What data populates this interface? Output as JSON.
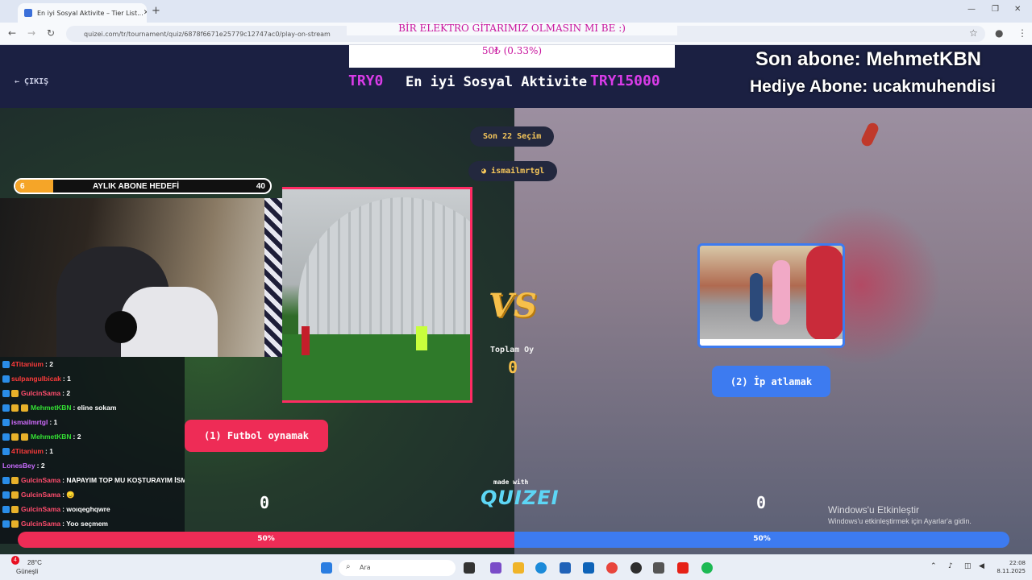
{
  "browser": {
    "tab_title": "En iyi Sosyal Aktivite – Tier List...",
    "url": "quizei.com/tr/tournament/quiz/6878f6671e25779c12747ac0/play-on-stream"
  },
  "header": {
    "exit_label": "ÇIKIŞ",
    "title": "En iyi Sosyal Aktivite",
    "try_left": "TRY0",
    "try_right": "TRY15000"
  },
  "donation": {
    "message": "BİR ELEKTRO GİTARIMIZ OLMASIN MI BE :)",
    "amount": "50₺ (0.33%)"
  },
  "subs": {
    "last_sub": "Son abone: MehmetKBN",
    "gift_sub": "Hediye Abone: ucakmuhendisi"
  },
  "info": {
    "last_picks": "Son 22 Seçim",
    "last_user": "ismailmrtgl"
  },
  "goal": {
    "title": "AYLIK ABONE HEDEFİ",
    "current": "6",
    "target": "40",
    "progress": 0.15
  },
  "chat": [
    {
      "user": "4Titanium",
      "msg": ": 2",
      "color": "#ff3b3b",
      "badges": 1
    },
    {
      "user": "sulpangulbicak",
      "msg": ": 1",
      "color": "#ff3b3b",
      "badges": 1
    },
    {
      "user": "GulcinSama",
      "msg": ": 2",
      "color": "#ff4d6d",
      "badges": 2
    },
    {
      "user": "MehmetKBN",
      "msg": ": eline sokam",
      "color": "#34e034",
      "badges": 3
    },
    {
      "user": "ismailmrtgl",
      "msg": ": 1",
      "color": "#d26cff",
      "badges": 1
    },
    {
      "user": "MehmetKBN",
      "msg": ": 2",
      "color": "#34e034",
      "badges": 3
    },
    {
      "user": "4Titanium",
      "msg": ": 1",
      "color": "#ff3b3b",
      "badges": 1
    },
    {
      "user": "LonesBey",
      "msg": ": 2",
      "color": "#c96cff",
      "badges": 0
    },
    {
      "user": "GulcinSama",
      "msg": ": NAPAYIM TOP MU KOŞTURAYIM İSMAİL",
      "color": "#ff4d6d",
      "badges": 2
    },
    {
      "user": "GulcinSama",
      "msg": ": 😞",
      "color": "#ff4d6d",
      "badges": 2
    },
    {
      "user": "GulcinSama",
      "msg": ": woıqeghqwre",
      "color": "#ff4d6d",
      "badges": 2
    },
    {
      "user": "GulcinSama",
      "msg": ": Yoo seçmem",
      "color": "#ff4d6d",
      "badges": 2
    }
  ],
  "options": {
    "left_label": "(1) Futbol oynamak",
    "right_label": "(2) İp atlamak",
    "left_score": "0",
    "right_score": "0",
    "left_pct": "50%",
    "right_pct": "50%",
    "left_color": "#ee2c56",
    "right_color": "#3d7bf0"
  },
  "center": {
    "vs": "VS",
    "total_label": "Toplam Oy",
    "total_value": "0",
    "made_with": "made with",
    "brand": "QUIZEI"
  },
  "windows_activate": {
    "line1": "Windows'u Etkinleştir",
    "line2": "Windows'u etkinleştirmek için Ayarlar'a gidin."
  },
  "taskbar": {
    "weather_badge": "4",
    "temperature": "28°C",
    "weather_text": "Güneşli",
    "search_placeholder": "Ara",
    "time": "22:08",
    "date": "8.11.2025"
  }
}
